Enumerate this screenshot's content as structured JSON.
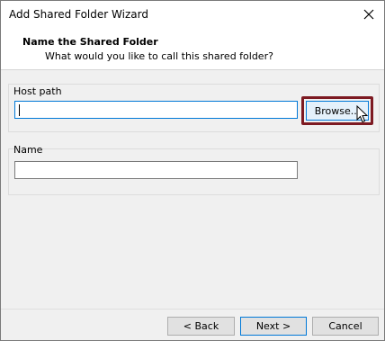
{
  "window": {
    "title": "Add Shared Folder Wizard"
  },
  "header": {
    "title": "Name the Shared Folder",
    "subtitle": "What would you like to call this shared folder?"
  },
  "host_path": {
    "label": "Host path",
    "value": "",
    "browse_label": "Browse..."
  },
  "name": {
    "label": "Name",
    "value": ""
  },
  "footer": {
    "back_label": "< Back",
    "next_label": "Next >",
    "cancel_label": "Cancel"
  },
  "colors": {
    "highlight": "#7d1a22",
    "focus": "#0078d7"
  },
  "icons": [
    "close-icon",
    "mouse-pointer-icon"
  ]
}
